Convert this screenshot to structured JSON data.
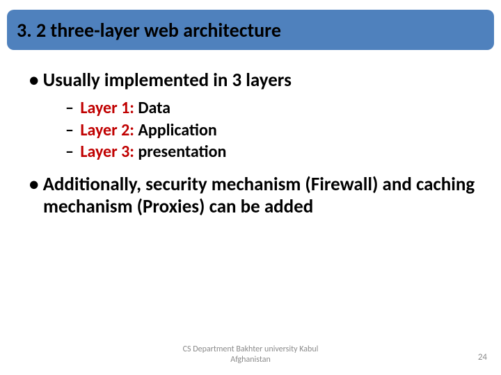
{
  "title": "3. 2 three-layer web architecture",
  "bullets": [
    "Usually implemented in 3 layers",
    "Additionally, security mechanism (Firewall) and caching mechanism (Proxies) can be added"
  ],
  "layers": [
    {
      "label": "Layer 1:",
      "value": "Data"
    },
    {
      "label": "Layer 2:",
      "value": "Application"
    },
    {
      "label": "Layer 3:",
      "value": "presentation"
    }
  ],
  "footer": {
    "line1": "CS Department Bakhter university Kabul",
    "line2": "Afghanistan"
  },
  "page_number": "24"
}
